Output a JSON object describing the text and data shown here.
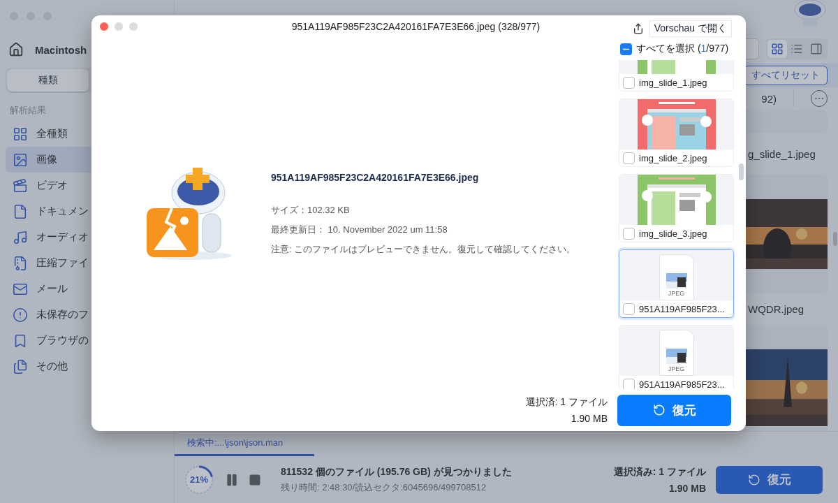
{
  "app": {
    "sidebar": {
      "location": "Macintosh",
      "tabs": [
        {
          "label": "種類",
          "selected": true
        }
      ],
      "section_title": "解析結果",
      "items": [
        {
          "label": "全種類",
          "selected": false
        },
        {
          "label": "画像",
          "selected": true
        },
        {
          "label": "ビデオ",
          "selected": false
        },
        {
          "label": "ドキュメン",
          "selected": false
        },
        {
          "label": "オーディオ",
          "selected": false
        },
        {
          "label": "圧縮ファイ",
          "selected": false
        },
        {
          "label": "メール",
          "selected": false
        },
        {
          "label": "未保存のフ",
          "selected": false
        },
        {
          "label": "ブラウザの",
          "selected": false
        },
        {
          "label": "その他",
          "selected": false
        }
      ]
    },
    "toolbar": {
      "view_modes": [
        {
          "selected": true
        },
        {
          "selected": false
        },
        {
          "selected": false
        }
      ]
    },
    "filter": {
      "reset_button": "すべてリセット"
    },
    "header": {
      "count": "92)"
    },
    "grid": {
      "labels": [
        "g_slide_1.jpeg",
        "WQDR.jpeg"
      ]
    },
    "status": {
      "scan_tab": "検索中:...\\json\\json.man",
      "progress": {
        "level": 0.21,
        "label": "21%"
      },
      "found": "811532 個のファイル (195.76 GB) が見つかりました",
      "remaining": "残り時間: 2:48:30/読込セクタ:6045696/499708512",
      "selected_files": "選択済み: 1 ファイル",
      "selected_size": "1.90 MB",
      "recover_button": "復元"
    }
  },
  "preview": {
    "title": "951A119AF985F23C2A420161FA7E3E66.jpeg (328/977)",
    "open_button": "Vorschau で開く",
    "select_all": {
      "indeterminate": true,
      "label": "すべてを選択 (",
      "count": "1",
      "rest": "/977)"
    },
    "file": {
      "name": "951A119AF985F23C2A420161FA7E3E66.jpeg",
      "details": [
        "サイズ：102.32 KB",
        "最終更新日：  10. November 2022 um 11:58",
        "注意: このファイルはプレビューできません。復元して確認してください。"
      ]
    },
    "thumbnails": [
      {
        "kind": "picture",
        "name": "img_slide_1.jpeg",
        "checked": false,
        "selected": false
      },
      {
        "kind": "picture",
        "name": "img_slide_2.jpeg",
        "checked": false,
        "selected": false
      },
      {
        "kind": "picture",
        "name": "img_slide_3.jpeg",
        "checked": false,
        "selected": false
      },
      {
        "kind": "file",
        "badge": "JPEG",
        "name": "951A119AF985F23...",
        "checked": false,
        "selected": true
      },
      {
        "kind": "file",
        "badge": "JPEG",
        "name": "951A119AF985F23...",
        "checked": false,
        "selected": false
      }
    ],
    "footer": {
      "selected_files": "選択済: 1 ファイル",
      "selected_size": "1.90 MB",
      "recover_button": "復元"
    }
  }
}
